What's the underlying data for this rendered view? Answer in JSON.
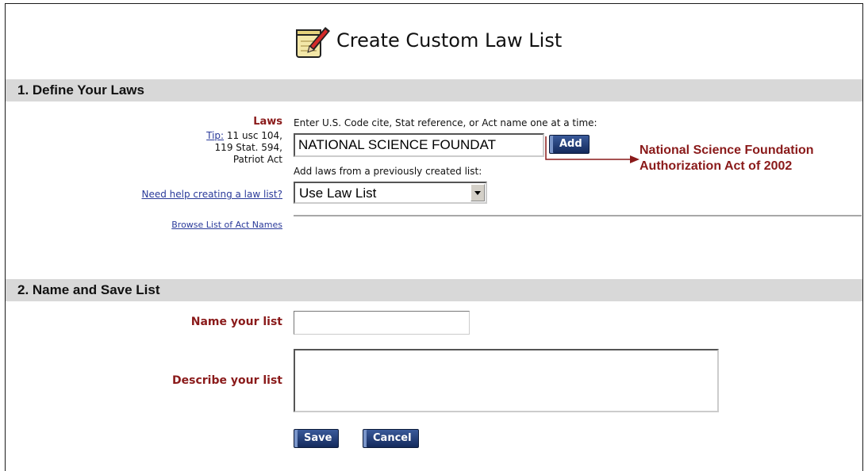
{
  "page": {
    "title": "Create Custom Law List"
  },
  "section1": {
    "heading": "1. Define Your Laws",
    "laws_label": "Laws",
    "tip_link": "Tip:",
    "tip_text_1": "11 usc 104,",
    "tip_text_2": "119 Stat. 594,",
    "tip_text_3": "Patriot Act",
    "instruction": "Enter U.S. Code cite, Stat reference, or Act name one at a time:",
    "law_input_value": "NATIONAL SCIENCE FOUNDAT",
    "add_button": "Add",
    "previous_list_label": "Add laws from a previously created list:",
    "law_list_select": "Use Law List",
    "help_link": "Need help creating a law list?",
    "browse_link": "Browse List of Act Names"
  },
  "annotation": {
    "line1": "National Science Foundation",
    "line2": "Authorization Act of 2002",
    "color": "#8a1a1a"
  },
  "section2": {
    "heading": "2. Name and Save List",
    "name_label": "Name your list",
    "name_value": "",
    "describe_label": "Describe your list",
    "describe_value": "",
    "save_button": "Save",
    "cancel_button": "Cancel"
  },
  "colors": {
    "label_red": "#8a1a1a",
    "link_blue": "#2a3a9a",
    "section_bar": "#d8d8d8",
    "button_navy": "#142a5c"
  },
  "icons": {
    "title_icon": "notepad-pencil-icon",
    "select_arrow": "chevron-down-icon",
    "annotation_arrow": "arrow-right-icon"
  }
}
